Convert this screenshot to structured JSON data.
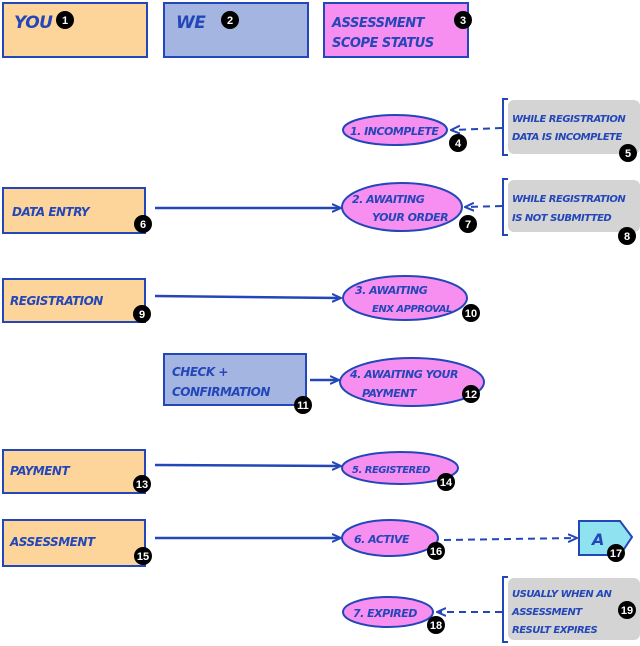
{
  "colors": {
    "you": "#fdd59a",
    "we": "#a4b5e2",
    "status": "#f78ff0",
    "note": "#d4d4d4",
    "artifact": "#8fe3f0",
    "ink": "#2346b8"
  },
  "lanes": {
    "you": {
      "label": "You",
      "badge": "1"
    },
    "we": {
      "label": "We",
      "badge": "2"
    },
    "status": {
      "line1": "Assessment",
      "line2": "Scope status",
      "badge": "3"
    }
  },
  "statuses": [
    {
      "line1": "1. Incomplete",
      "line2": "",
      "badge": "4"
    },
    {
      "line1": "2. Awaiting",
      "line2": "your order",
      "badge": "7"
    },
    {
      "line1": "3. Awaiting",
      "line2": "ENX Approval",
      "badge": "10"
    },
    {
      "line1": "4. Awaiting your",
      "line2": "Payment",
      "badge": "12"
    },
    {
      "line1": "5. Registered",
      "line2": "",
      "badge": "14"
    },
    {
      "line1": "6. Active",
      "line2": "",
      "badge": "16"
    },
    {
      "line1": "7. Expired",
      "line2": "",
      "badge": "18"
    }
  ],
  "actions": [
    {
      "label": "Data entry",
      "badge": "6"
    },
    {
      "label": "Registration",
      "badge": "9"
    },
    {
      "line1": "Check +",
      "line2": "Confirmation",
      "badge": "11"
    },
    {
      "label": "Payment",
      "badge": "13"
    },
    {
      "label": "Assessment",
      "badge": "15"
    }
  ],
  "notes": [
    {
      "line1": "While Registration",
      "line2": "data is incomplete",
      "badge": "5"
    },
    {
      "line1": "While registration",
      "line2": "is not submitted",
      "badge": "8"
    },
    {
      "line1": "Usually when an",
      "line2": "assessment",
      "line3": "result expires",
      "badge": "19"
    }
  ],
  "artifact": {
    "label": "A",
    "badge": "17"
  }
}
